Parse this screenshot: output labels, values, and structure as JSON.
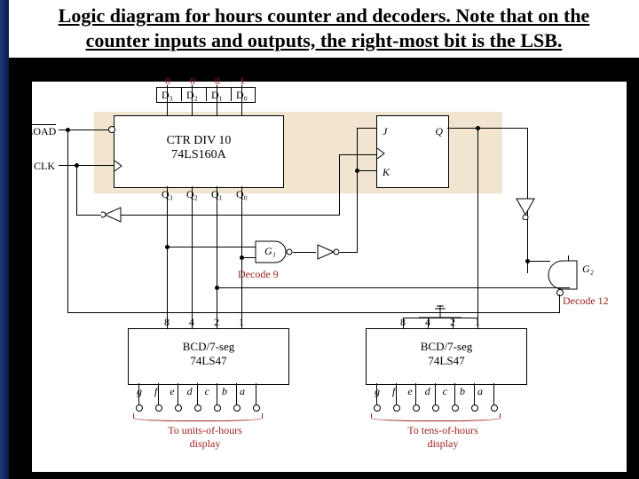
{
  "title": "Logic diagram for hours counter and decoders. Note that on the counter inputs and outputs, the right-most bit is the LSB.",
  "preset": {
    "d3": "0",
    "d2": "0",
    "d1": "0",
    "d0": "1"
  },
  "counter": {
    "d_labels": [
      "D₃",
      "D₂",
      "D₁",
      "D₀"
    ],
    "name_top": "CTR DIV 10",
    "name_bot": "74LS160A",
    "q_labels": [
      "Q₃",
      "Q₂",
      "Q₁",
      "Q₀"
    ]
  },
  "jk": {
    "j": "J",
    "k": "K",
    "q": "Q"
  },
  "signals": {
    "load": "LOAD",
    "clk": "CLK"
  },
  "gates": {
    "g1": "G₁",
    "g2": "G₂",
    "decode9": "Decode 9",
    "decode12": "Decode 12"
  },
  "weights": {
    "w8": "8",
    "w4": "4",
    "w2": "2",
    "w1": "1"
  },
  "decoder": {
    "name_top": "BCD/7-seg",
    "name_bot": "74LS47",
    "outs": [
      "g",
      "f",
      "e",
      "d",
      "c",
      "b",
      "a"
    ]
  },
  "captions": {
    "units": "To units-of-hours display",
    "tens": "To tens-of-hours display"
  }
}
